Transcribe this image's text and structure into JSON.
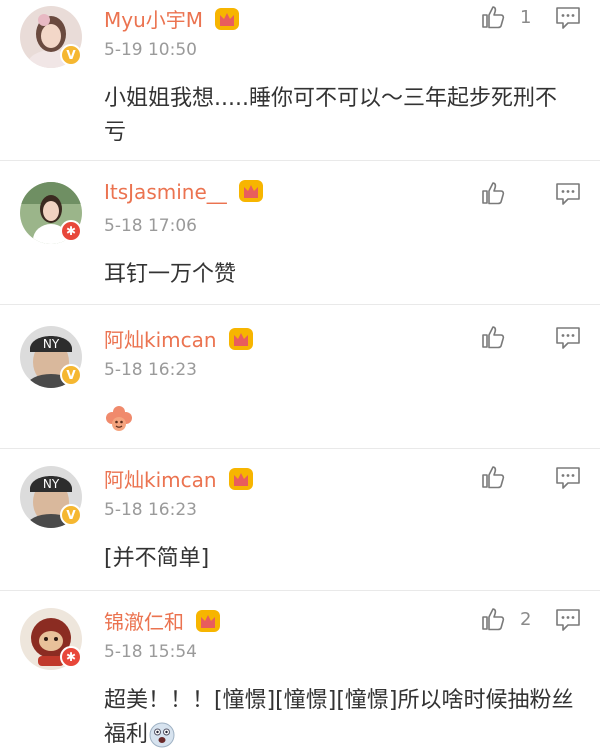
{
  "comments": [
    {
      "username": "Myu小宇M",
      "time": "5-19 10:50",
      "text": "小姐姐我想.....睡你可不可以～三年起步死刑不亏",
      "likes": "1",
      "badge": "V",
      "badge_color": "#f5b731"
    },
    {
      "username": "ItsJasmine__",
      "time": "5-18 17:06",
      "text": "耳钉一万个赞",
      "likes": "",
      "badge": "✱",
      "badge_color": "#e8473a"
    },
    {
      "username": "阿灿kimcan",
      "time": "5-18 16:23",
      "text": "",
      "likes": "",
      "badge": "V",
      "badge_color": "#f5b731",
      "emoji": "flower-emoji"
    },
    {
      "username": "阿灿kimcan",
      "time": "5-18 16:23",
      "text": "[并不简单]",
      "likes": "",
      "badge": "V",
      "badge_color": "#f5b731"
    },
    {
      "username": "锦澈仁和",
      "time": "5-18 15:54",
      "text": "超美！！！[憧憬][憧憬][憧憬]所以啥时候抽粉丝福利",
      "likes": "2",
      "badge": "✱",
      "badge_color": "#e8473a",
      "emoji": "wow-face-emoji"
    }
  ],
  "colors": {
    "username": "#eb7350",
    "time": "#9a9a9a",
    "text": "#333333",
    "divider": "#e9e9e9"
  },
  "icons": {
    "like": "thumbs-up-icon",
    "reply": "comment-bubble-icon",
    "crown": "crown-vip-icon"
  }
}
